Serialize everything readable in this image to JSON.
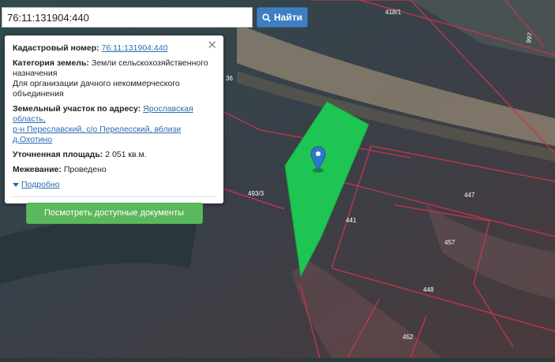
{
  "search": {
    "value": "76:11:131904:440",
    "button_label": "Найти"
  },
  "popup": {
    "cadastral_label": "Кадастровый номер:",
    "cadastral_number": "76:11:131904:440",
    "category_label": "Категория земель:",
    "category_value_line1": "Земли сельскохозяйственного",
    "category_value_line2": "назначения",
    "permitted_use": "Для организации дачного некоммерческого объединения",
    "address_label": "Земельный участок по адресу:",
    "address_line1": "Ярославская область,",
    "address_line2": "р-н Переславский, с/о Перелесский, вблизи д.Охотино",
    "area_label": "Уточненная площадь:",
    "area_value": "2 051 кв.м.",
    "survey_label": "Межевание:",
    "survey_value": "Проведено",
    "more_label": "Подробно",
    "docs_button": "Посмотреть доступные документы"
  },
  "map": {
    "parcel_labels": [
      "418/1",
      "997",
      "36",
      "493/3",
      "441",
      "447",
      "457",
      "448",
      "452"
    ],
    "colors": {
      "selected_parcel": "#1ec552",
      "boundary": "#c8354b",
      "marker": "#2c78c9"
    }
  }
}
